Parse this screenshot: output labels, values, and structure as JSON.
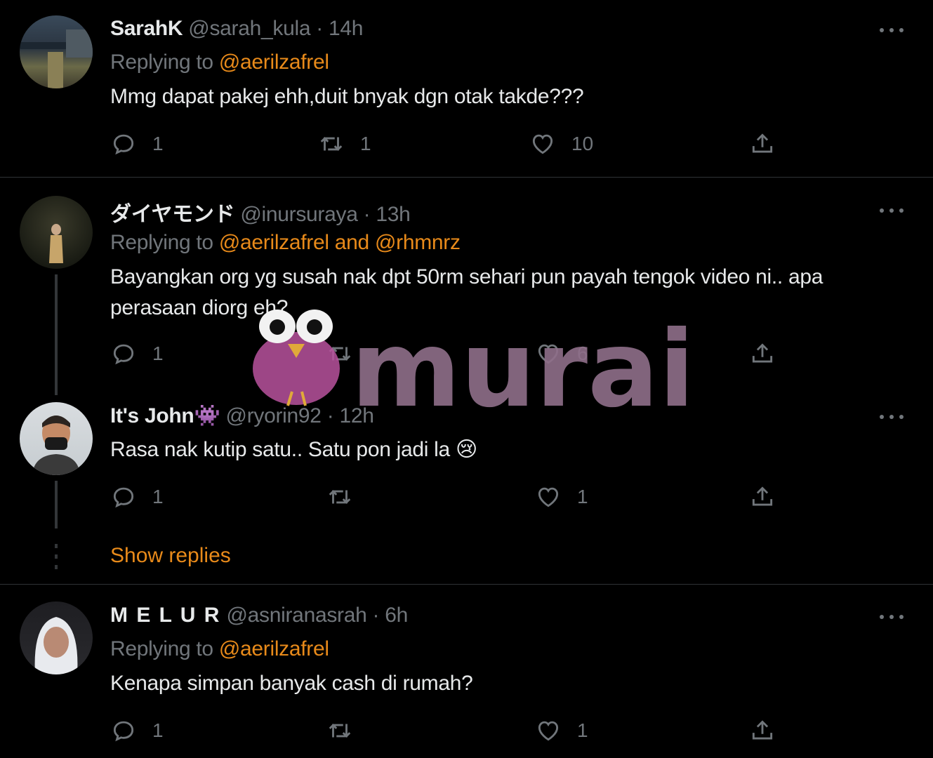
{
  "tweets": [
    {
      "name": "SarahK",
      "handle": "@sarah_kula",
      "time": "14h",
      "reply_prefix": "Replying to",
      "reply_mentions": "@aerilzafrel",
      "text": "Mmg dapat pakej ehh,duit bnyak dgn otak takde???",
      "replies": "1",
      "retweets": "1",
      "likes": "10"
    },
    {
      "name": "ダイヤモンド",
      "handle": "@inursuraya",
      "time": "13h",
      "reply_prefix": "Replying to",
      "reply_mentions": "@aerilzafrel and @rhmnrz",
      "text": "Bayangkan org yg  susah nak dpt 50rm sehari pun payah tengok video ni.. apa perasaan diorg eh?",
      "replies": "1",
      "retweets": "",
      "likes": "6"
    },
    {
      "name": "It's John👾",
      "handle": "@ryorin92",
      "time": "12h",
      "text": "Rasa nak kutip satu.. Satu pon jadi la 😢",
      "replies": "1",
      "retweets": "",
      "likes": "1"
    },
    {
      "name": "M E L U R",
      "handle": "@asniranasrah",
      "time": "6h",
      "reply_prefix": "Replying to",
      "reply_mentions": "@aerilzafrel",
      "text": "Kenapa simpan banyak cash di rumah?",
      "replies": "1",
      "retweets": "",
      "likes": "1"
    }
  ],
  "show_replies": "Show replies",
  "watermark": {
    "text": "murai"
  },
  "colors": {
    "background": "#000000",
    "accent": "#e88a1a",
    "muted": "#71767b",
    "text": "#e7e9ea",
    "divider": "#2f3336"
  }
}
